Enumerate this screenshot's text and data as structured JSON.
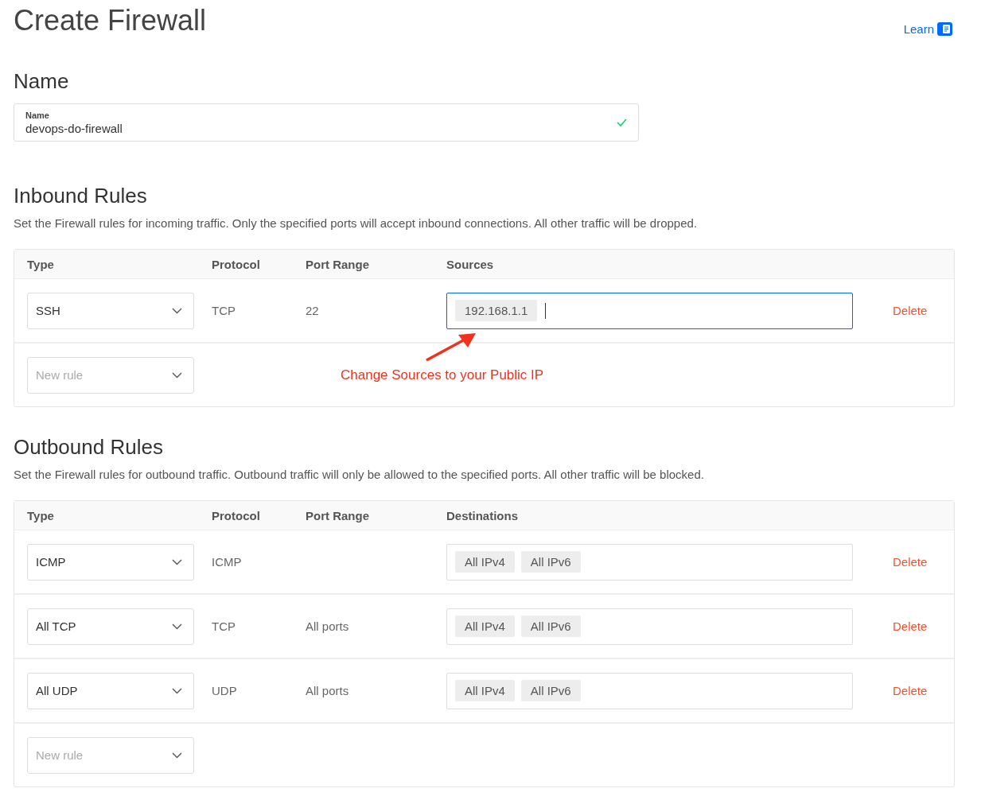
{
  "title": "Create Firewall",
  "learn_link": {
    "label": "Learn"
  },
  "name_section": {
    "heading": "Name",
    "field": {
      "label": "Name",
      "value": "devops-do-firewall",
      "valid": true
    }
  },
  "inbound": {
    "heading": "Inbound Rules",
    "description": "Set the Firewall rules for incoming traffic. Only the specified ports will accept inbound connections. All other traffic will be dropped.",
    "columns": [
      "Type",
      "Protocol",
      "Port Range",
      "Sources"
    ],
    "rows": [
      {
        "type": "SSH",
        "protocol": "TCP",
        "port_range": "22",
        "targets": [
          "192.168.1.1"
        ],
        "focused": true,
        "action": "Delete"
      }
    ],
    "new_rule": {
      "placeholder": "New rule"
    },
    "annotation": {
      "text": "Change Sources to your Public IP"
    }
  },
  "outbound": {
    "heading": "Outbound Rules",
    "description": "Set the Firewall rules for outbound traffic. Outbound traffic will only be allowed to the specified ports. All other traffic will be blocked.",
    "columns": [
      "Type",
      "Protocol",
      "Port Range",
      "Destinations"
    ],
    "rows": [
      {
        "type": "ICMP",
        "protocol": "ICMP",
        "port_range": "",
        "targets": [
          "All IPv4",
          "All IPv6"
        ],
        "focused": false,
        "action": "Delete"
      },
      {
        "type": "All TCP",
        "protocol": "TCP",
        "port_range": "All ports",
        "targets": [
          "All IPv4",
          "All IPv6"
        ],
        "focused": false,
        "action": "Delete"
      },
      {
        "type": "All UDP",
        "protocol": "UDP",
        "port_range": "All ports",
        "targets": [
          "All IPv4",
          "All IPv6"
        ],
        "focused": false,
        "action": "Delete"
      }
    ],
    "new_rule": {
      "placeholder": "New rule"
    }
  }
}
